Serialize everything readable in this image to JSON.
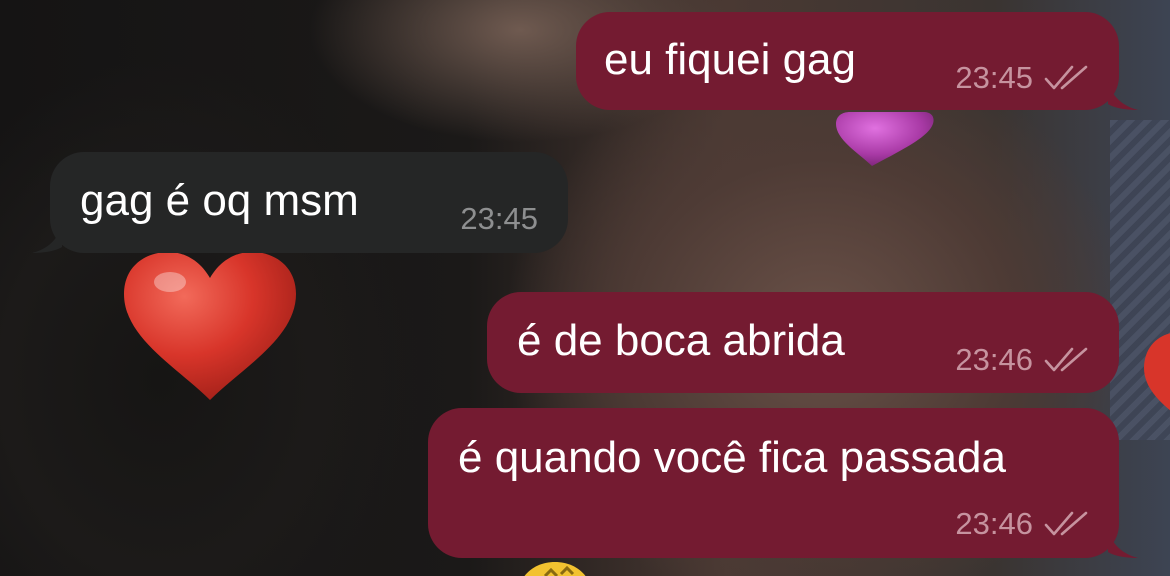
{
  "chat": {
    "messages": [
      {
        "direction": "outgoing",
        "text": "eu fiquei gag",
        "time": "23:45",
        "status_icon": "double-check-icon"
      },
      {
        "direction": "incoming",
        "text": "gag é oq msm",
        "time": "23:45"
      },
      {
        "direction": "outgoing",
        "text": "é de boca abrida",
        "time": "23:46",
        "status_icon": "double-check-icon"
      },
      {
        "direction": "outgoing",
        "text": "é quando você fica passada",
        "time": "23:46",
        "status_icon": "double-check-icon"
      }
    ]
  },
  "colors": {
    "outgoing_bubble": "#741b31",
    "incoming_bubble": "#252626",
    "message_text": "#ffffff",
    "outgoing_meta": "#c6939f",
    "incoming_meta": "#8e8f90"
  },
  "wallpaper": {
    "decorations": [
      "red-heart-icon",
      "purple-heart-icon",
      "yellow-emoji-icon"
    ]
  }
}
